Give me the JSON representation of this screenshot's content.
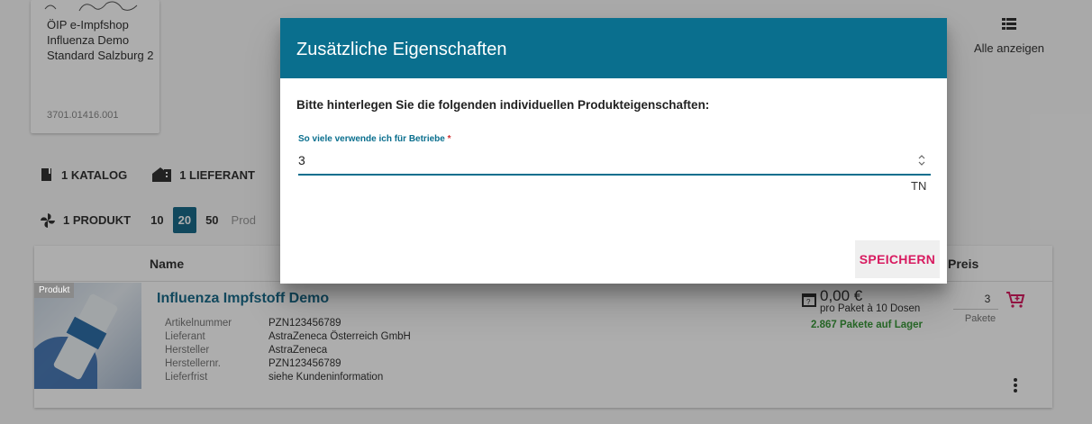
{
  "product_card": {
    "title": "ÖIP e-Impfshop Influenza Demo Standard Salzburg 2",
    "code": "3701.01416.001"
  },
  "show_all": {
    "label": "Alle anzeigen",
    "icon": "list-icon"
  },
  "filters": {
    "catalog": "1 KATALOG",
    "supplier": "1 LIEFERANT",
    "products": "1 PRODUKT"
  },
  "pagination": {
    "sizes": [
      "10",
      "20",
      "50"
    ],
    "active": "20",
    "trailing": "Prod"
  },
  "table": {
    "headers": {
      "name": "Name",
      "price": "Preis"
    },
    "row": {
      "badge": "Produkt",
      "name": "Influenza Impfstoff Demo",
      "attributes": [
        {
          "key": "Artikelnummer",
          "value": "PZN123456789"
        },
        {
          "key": "Lieferant",
          "value": "AstraZeneca Österreich GmbH"
        },
        {
          "key": "Hersteller",
          "value": "AstraZeneca"
        },
        {
          "key": "Herstellernr.",
          "value": "PZN123456789"
        },
        {
          "key": "Lieferfrist",
          "value": "siehe Kundeninformation"
        }
      ],
      "price": "0,00 €",
      "per_pack": "pro Paket à 10 Dosen",
      "stock": "2.867 Pakete auf Lager",
      "quantity": "3",
      "quantity_unit": "Pakete"
    }
  },
  "dialog": {
    "title": "Zusätzliche Eigenschaften",
    "intro": "Bitte hinterlegen Sie die folgenden individuellen Produkteigenschaften:",
    "field_label": "So viele verwende ich für Betriebe",
    "field_required_mark": "*",
    "field_value": "3",
    "field_suffix": "TN",
    "save_label": "SPEICHERN"
  },
  "colors": {
    "primary": "#0a6f8e",
    "accent": "#d81b60",
    "stock": "#3a9a3a"
  }
}
